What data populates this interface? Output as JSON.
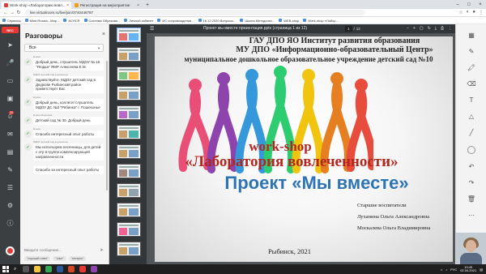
{
  "browser": {
    "tabs": [
      {
        "label": "Work-shop «Лабораторию вовл...",
        "active": true
      },
      {
        "label": "Регистрация на мероприятие",
        "active": false
      }
    ],
    "url": "live.virtualroom.ru/live/join/3740446787",
    "bookmarks": [
      "Сервисы",
      "Mind Russia - Мар...",
      "ACHCR",
      "Система Образова...",
      "Личный кабинет",
      "ИС сопровождения...",
      "16.12.2020 Вопросы...",
      "Школа Методичес...",
      "WEB-shop",
      "Work-shop «Лабор..."
    ]
  },
  "leftbar": {
    "rec_label": "REC",
    "badge": "20"
  },
  "chat": {
    "title": "Разговоры",
    "filter_value": "Все",
    "input_placeholder": "Введите сообщение...",
    "chips": [
      "\"хороший ответ\"",
      "\"опыт\"",
      "\"интерес\""
    ],
    "messages": [
      {
        "author": "Елена",
        "text": "Добрый день, слушатель МДОУ № 16 \"Ягодка\" ЯМР Алексеева Е.М."
      },
      {
        "author": "МДОУ детский сад в дошколье",
        "text": "Здравствуйте. МДОУ детский сад в Дюдкове Рыбинский район приветствует Вас"
      },
      {
        "author": "Елена",
        "text": "Добрый день, коллеги! слушатель МДОУ ДС №3 \"Рябинка\" г. Пошехонье"
      },
      {
        "author": "Елена Морозова",
        "text": "Детский сад № 30. Добрый день"
      },
      {
        "author": "Елена",
        "text": "Спасибо интересный опыт работы"
      },
      {
        "author": "МДОУ детский сад в дошколье",
        "text": "Мы используем песенницы, для детей с отр в группе компенсирующей направленности."
      },
      {
        "author": "",
        "text": "Спасибо за интересный опыт работы"
      }
    ]
  },
  "thumbs": {
    "label": "Слайды"
  },
  "pdf": {
    "title": "Проект мы вместе презентация.pptx (страница 1 из 12)",
    "page_current": "1",
    "page_total": "12",
    "tool_zoom": "−",
    "tool_plus": "+"
  },
  "slide": {
    "head1": "ГАУ ДПО ЯО Институт развития образования",
    "head2": "МУ ДПО «Информационно-образовательный Центр»",
    "head3": "муниципальное дошкольное образовательное учреждение детский сад №10",
    "workshop": "work-shop",
    "lab": "«Лаборатория вовлеченности»",
    "project": "Проект «Мы вместе»",
    "teachers": "Старшие воспитатели",
    "name1": "Луханина Ольга Александровна",
    "name2": "Москалева Ольга Владимировна",
    "city": "Рыбинск, 2021",
    "ribbon_colors": [
      "#e94e77",
      "#8e44ad",
      "#3498db",
      "#2ecc71",
      "#f1c40f",
      "#e67e22",
      "#e74c3c"
    ]
  },
  "taskbar": {
    "lang": "РУС",
    "time": "13:49",
    "date": "02.04.2021"
  }
}
